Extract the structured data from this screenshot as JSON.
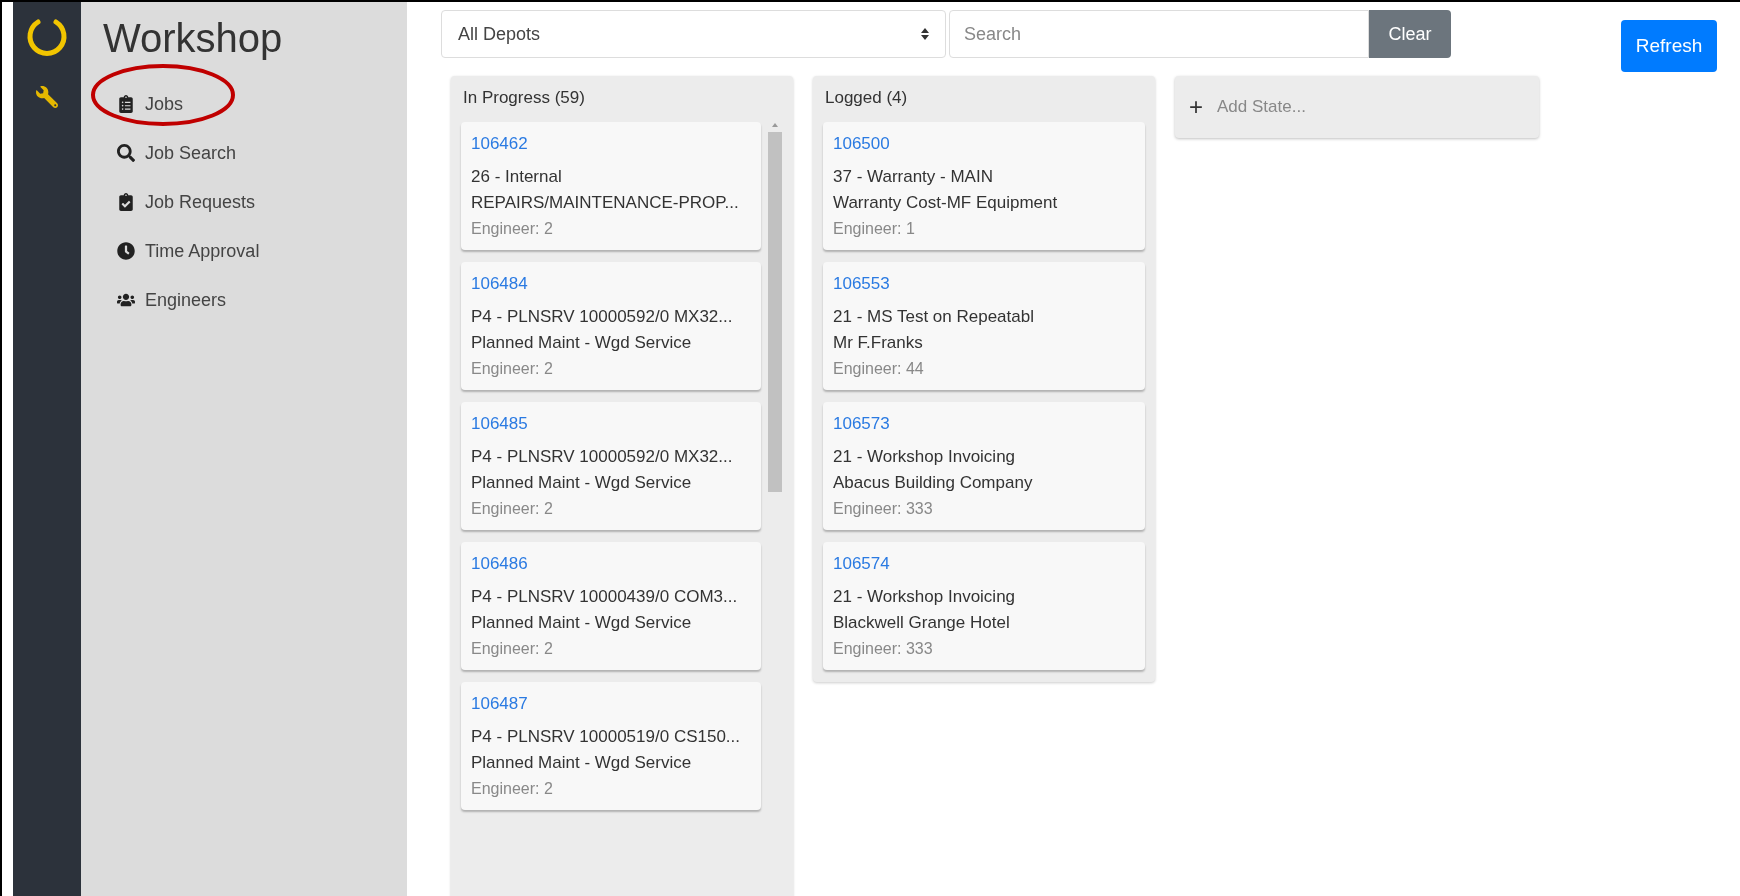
{
  "app": {
    "title": "Workshop"
  },
  "sidebar": {
    "items": [
      {
        "label": "Jobs",
        "circled": true
      },
      {
        "label": "Job Search",
        "circled": false
      },
      {
        "label": "Job Requests",
        "circled": false
      },
      {
        "label": "Time Approval",
        "circled": false
      },
      {
        "label": "Engineers",
        "circled": false
      }
    ]
  },
  "toolbar": {
    "depot_select": "All Depots",
    "search": {
      "placeholder": "Search"
    },
    "clear_button": "Clear",
    "refresh_button": "Refresh"
  },
  "columns": [
    {
      "title": "In Progress (59)",
      "scrollable": true,
      "cards": [
        {
          "number": "106462",
          "line_1": "26 - Internal",
          "line_2": "REPAIRS/MAINTENANCE-PROP...",
          "engineer": "Engineer: 2"
        },
        {
          "number": "106484",
          "line_1": "P4 - PLNSRV 10000592/0 MX32...",
          "line_2": "Planned Maint - Wgd Service",
          "engineer": "Engineer: 2"
        },
        {
          "number": "106485",
          "line_1": "P4 - PLNSRV 10000592/0 MX32...",
          "line_2": "Planned Maint - Wgd Service",
          "engineer": "Engineer: 2"
        },
        {
          "number": "106486",
          "line_1": "P4 - PLNSRV 10000439/0 COM3...",
          "line_2": "Planned Maint - Wgd Service",
          "engineer": "Engineer: 2"
        },
        {
          "number": "106487",
          "line_1": "P4 - PLNSRV 10000519/0 CS150...",
          "line_2": "Planned Maint - Wgd Service",
          "engineer": "Engineer: 2"
        }
      ]
    },
    {
      "title": "Logged (4)",
      "scrollable": false,
      "cards": [
        {
          "number": "106500",
          "line_1": "37 - Warranty - MAIN",
          "line_2": "Warranty Cost-MF Equipment",
          "engineer": "Engineer: 1"
        },
        {
          "number": "106553",
          "line_1": "21 - MS Test on Repeatabl",
          "line_2": "Mr F.Franks",
          "engineer": "Engineer: 44"
        },
        {
          "number": "106573",
          "line_1": "21 - Workshop Invoicing",
          "line_2": "Abacus Building Company",
          "engineer": "Engineer: 333"
        },
        {
          "number": "106574",
          "line_1": "21 - Workshop Invoicing",
          "line_2": "Blackwell Grange Hotel",
          "engineer": "Engineer: 333"
        }
      ]
    }
  ],
  "add_state": {
    "icon": "+",
    "label": "Add State..."
  }
}
